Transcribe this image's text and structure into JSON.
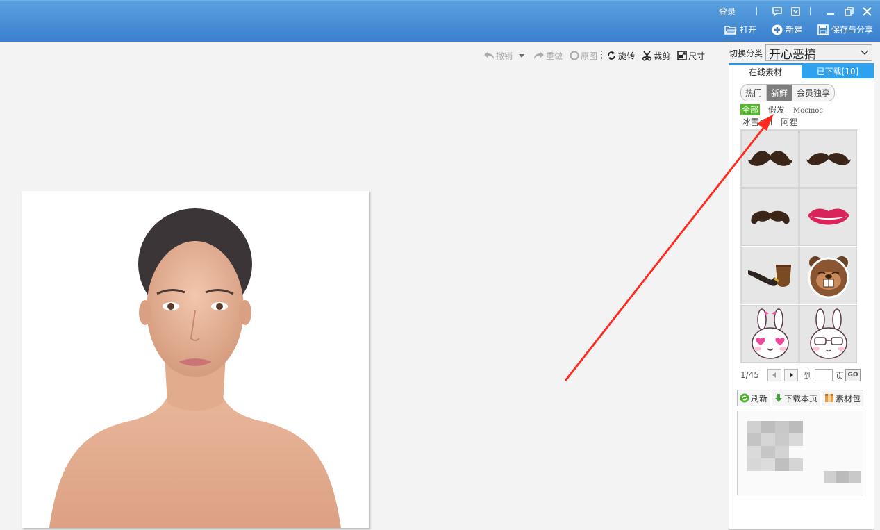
{
  "titlebar": {
    "login": "登录",
    "open_label": "打开",
    "new_label": "新建",
    "save_share_label": "保存与分享"
  },
  "toolbar": {
    "undo": "撤销",
    "redo": "重做",
    "original": "原图",
    "rotate": "旋转",
    "crop": "裁剪",
    "size": "尺寸"
  },
  "category": {
    "label": "切换分类",
    "selected": "开心恶搞"
  },
  "panel": {
    "tabs": [
      {
        "label": "在线素材",
        "active": true
      },
      {
        "label": "已下载[10]",
        "active": false
      }
    ],
    "segments": [
      {
        "label": "热门",
        "active": false
      },
      {
        "label": "新鲜",
        "active": true
      },
      {
        "label": "会员独享",
        "active": false
      }
    ],
    "filters": [
      "全部",
      "假发",
      "Mocmoc",
      "冰雪girl",
      "阿狸"
    ],
    "stickers": [
      "mustache-1-icon",
      "mustache-2-icon",
      "mustache-3-icon",
      "lips-icon",
      "pipe-icon",
      "beaver-icon",
      "bunny-hearts-icon",
      "bunny-glasses-icon"
    ],
    "pager": {
      "page_text": "1/45",
      "goto_label": "到",
      "page_suffix": "页",
      "go_label": "GO"
    },
    "actions": {
      "refresh": "刷新",
      "download_page": "下载本页",
      "material_pack": "素材包"
    }
  },
  "colors": {
    "titlebar": "#4a90d9",
    "tab_active_border": "#2f8fe0",
    "tab_inactive": "#2ea2ef",
    "filter_active": "#55b82e",
    "annotation_arrow": "#ff2a1f"
  }
}
